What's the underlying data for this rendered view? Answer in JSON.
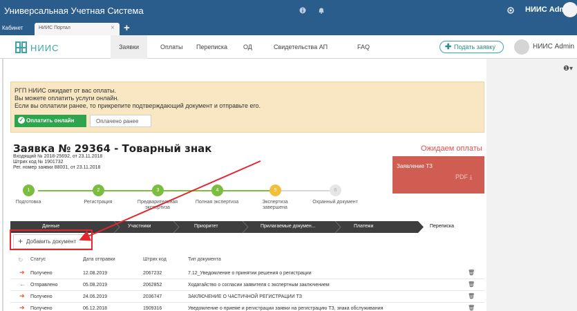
{
  "window": {
    "title": "Универсальная Учетная Система",
    "user": "НИИС Admin"
  },
  "tabs": {
    "section_label": "Кабинет",
    "active_tab": "НИИС Портал",
    "close": "×",
    "new_tab": "+"
  },
  "nav": {
    "brand": "НИИС",
    "links": [
      "Заявки",
      "Оплаты",
      "Переписка",
      "ОД",
      "Свидетельства АП",
      "FAQ"
    ],
    "apply_button": "Подать заявку",
    "user": "НИИС Admin",
    "help": "❶▾"
  },
  "notice": {
    "line1": "РГП НИИС ожидает от вас оплаты.",
    "line2": "Вы можете оплатить услуги онлайн.",
    "line3": "Если вы оплатили ранее, то прикрепите подтверждающий документ и отправьте его.",
    "pay_online": "Оплатить онлайн",
    "paid_earlier": "Оплачено ранее"
  },
  "application": {
    "title": "Заявка № 29364 - Товарный знак",
    "status": "Ожидаем оплаты",
    "incoming": "Входящий № 2018-25692, от 23.11.2018",
    "barcode": "Штрих код № 1901732",
    "reg_number": "Рег. номер заявки 88001, от 23.11.2018",
    "doc_card_title": "Заявление ТЗ",
    "doc_card_pdf": "PDF ⤓"
  },
  "steps": [
    {
      "num": "1",
      "label": "Подготовка"
    },
    {
      "num": "2",
      "label": "Регистрация"
    },
    {
      "num": "3",
      "label": "Предварительная экспертиза"
    },
    {
      "num": "4",
      "label": "Полная экспертиза"
    },
    {
      "num": "5",
      "label": "Экспертиза завершена"
    },
    {
      "num": "6",
      "label": "Охранный документ"
    }
  ],
  "section_tabs": [
    "Данные",
    "Участники",
    "Приоритет",
    "Прилагаемые докумен...",
    "Платежи",
    "Переписка"
  ],
  "add_document": "Добавить документ",
  "table": {
    "headers": [
      "Статус",
      "Дата отправки",
      "Штрих код",
      "Тип документа"
    ],
    "rows": [
      {
        "status": "Получено",
        "date": "12.08.2019",
        "barcode": "2067232",
        "type": "7.12_Уведомление о принятии решения о регистрации"
      },
      {
        "status": "Отправлено",
        "date": "05.08.2019",
        "barcode": "2062852",
        "type": "Ходатайство о согласии заявителя с экспертным заключением"
      },
      {
        "status": "Получено",
        "date": "24.06.2019",
        "barcode": "2036747",
        "type": "ЗАКЛЮЧЕНИЕ О ЧАСТИЧНОЙ РЕГИСТРАЦИИ ТЗ"
      },
      {
        "status": "Получено",
        "date": "06.12.2018",
        "barcode": "1909316",
        "type": "Уведомление о приеме и регистрации заявки на регистрацию ТЗ, знака обслуживания"
      }
    ]
  },
  "colors": {
    "brand": "#2a5d8c",
    "accent": "#3aa5a8",
    "alert": "#cf5d52",
    "success": "#2ea44e",
    "step_done": "#7bbd3e",
    "step_current": "#f0c03a"
  }
}
